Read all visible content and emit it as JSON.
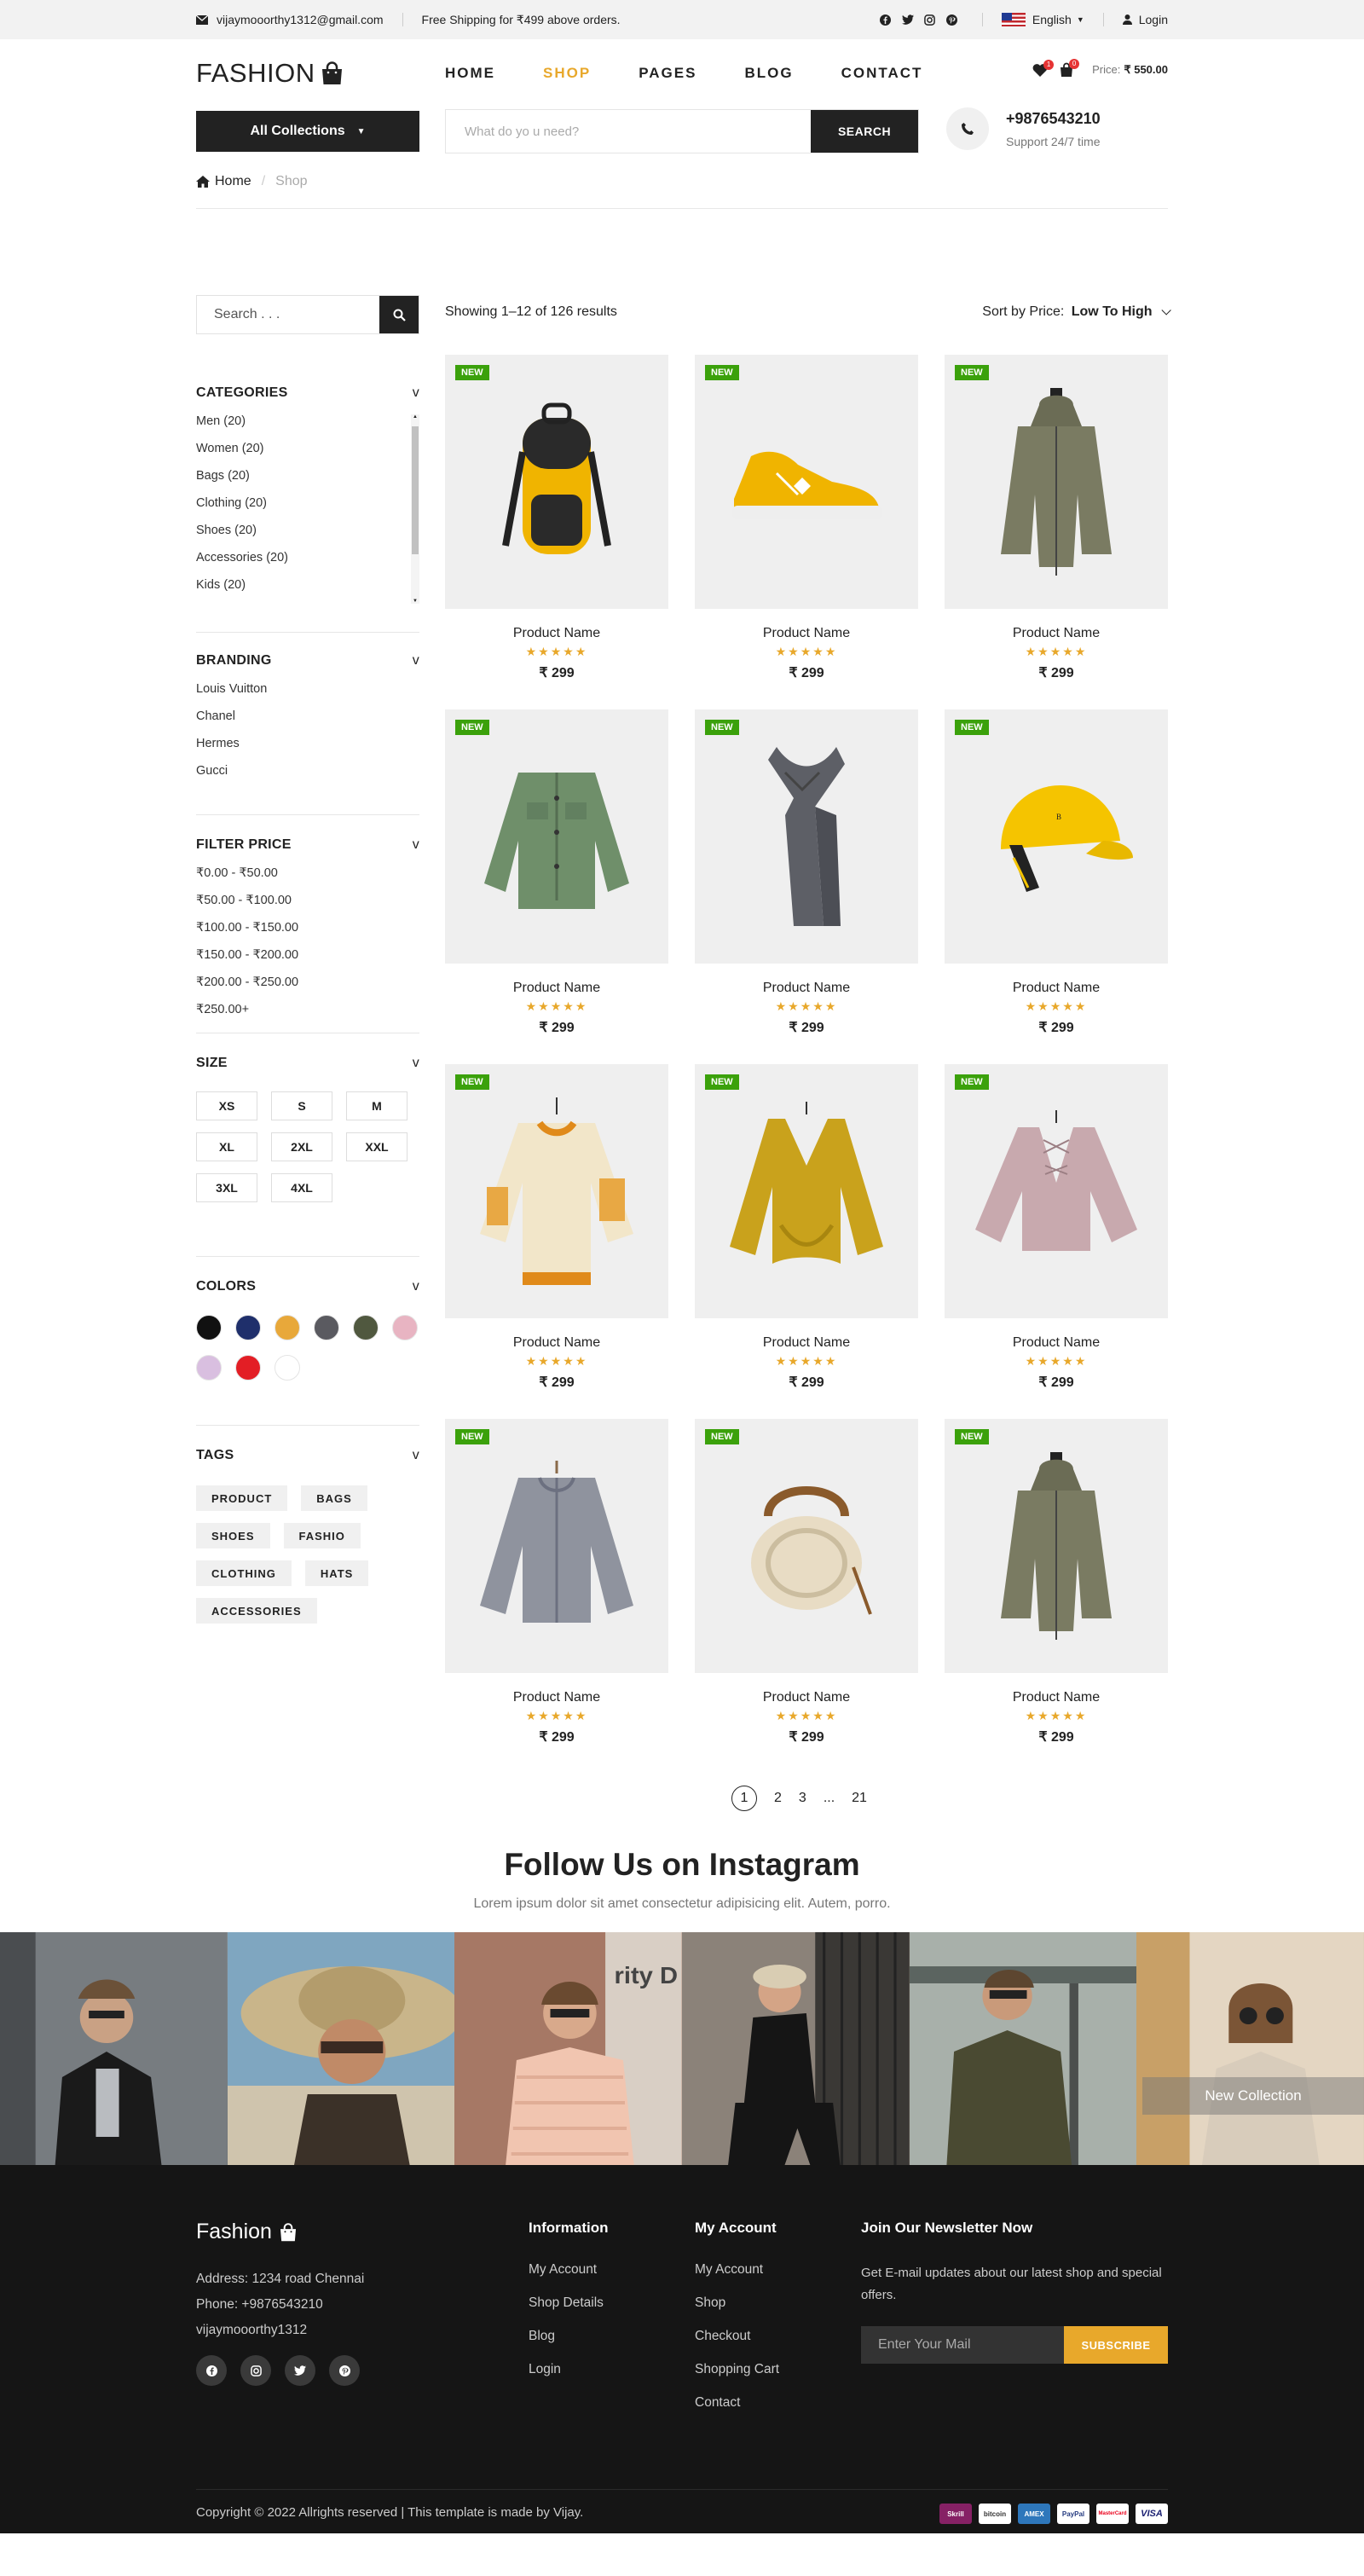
{
  "topbar": {
    "email": "vijaymooorthy1312@gmail.com",
    "shipping": "Free Shipping for ₹499 above orders.",
    "language": "English",
    "login": "Login"
  },
  "header": {
    "logo": "FASHION",
    "nav": [
      "HOME",
      "SHOP",
      "PAGES",
      "BLOG",
      "CONTACT"
    ],
    "active_nav": "SHOP",
    "wishlist_count": "1",
    "cart_count": "0",
    "price_label": "Price:",
    "price_value": "₹ 550.00"
  },
  "search": {
    "collections_label": "All Collections",
    "placeholder": "What do yo u need?",
    "button": "SEARCH"
  },
  "support": {
    "phone": "+9876543210",
    "text": "Support 24/7 time"
  },
  "breadcrumb": {
    "home": "Home",
    "current": "Shop"
  },
  "sidebar": {
    "search_placeholder": "Search . . .",
    "categories": {
      "title": "CATEGORIES",
      "items": [
        "Men (20)",
        "Women (20)",
        "Bags (20)",
        "Clothing (20)",
        "Shoes (20)",
        "Accessories (20)",
        "Kids (20)"
      ]
    },
    "branding": {
      "title": "BRANDING",
      "items": [
        "Louis Vuitton",
        "Chanel",
        "Hermes",
        "Gucci"
      ]
    },
    "price": {
      "title": "FILTER PRICE",
      "items": [
        "₹0.00 - ₹50.00",
        "₹50.00 - ₹100.00",
        "₹100.00 - ₹150.00",
        "₹150.00 - ₹200.00",
        "₹200.00 - ₹250.00",
        "₹250.00+"
      ]
    },
    "size": {
      "title": "SIZE",
      "items": [
        "XS",
        "S",
        "M",
        "XL",
        "2XL",
        "XXL",
        "3XL",
        "4XL"
      ]
    },
    "colors": {
      "title": "COLORS",
      "items": [
        "#111111",
        "#1f2f6b",
        "#e8a83a",
        "#5a5a60",
        "#50583f",
        "#e8b4c2",
        "#d9bfe0",
        "#e31e25",
        "#ffffff"
      ]
    },
    "tags": {
      "title": "TAGS",
      "items": [
        "PRODUCT",
        "BAGS",
        "SHOES",
        "FASHIO",
        "CLOTHING",
        "HATS",
        "ACCESSORIES"
      ]
    },
    "chevron": "v"
  },
  "shop": {
    "showing": "Showing 1–12 of 126 results",
    "sort_label": "Sort by Price:",
    "sort_value": "Low To High"
  },
  "products": [
    {
      "badge": "NEW",
      "name": "Product Name",
      "price": "₹ 299",
      "rating": 5,
      "icon": "backpack-image"
    },
    {
      "badge": "NEW",
      "name": "Product Name",
      "price": "₹ 299",
      "rating": 5,
      "icon": "sneaker-image"
    },
    {
      "badge": "NEW",
      "name": "Product Name",
      "price": "₹ 299",
      "rating": 5,
      "icon": "hooded-jacket-image"
    },
    {
      "badge": "NEW",
      "name": "Product Name",
      "price": "₹ 299",
      "rating": 5,
      "icon": "green-jacket-image"
    },
    {
      "badge": "NEW",
      "name": "Product Name",
      "price": "₹ 299",
      "rating": 5,
      "icon": "scarf-image"
    },
    {
      "badge": "NEW",
      "name": "Product Name",
      "price": "₹ 299",
      "rating": 5,
      "icon": "cap-image"
    },
    {
      "badge": "NEW",
      "name": "Product Name",
      "price": "₹ 299",
      "rating": 5,
      "icon": "cream-sweater-image"
    },
    {
      "badge": "NEW",
      "name": "Product Name",
      "price": "₹ 299",
      "rating": 5,
      "icon": "mustard-sweater-image"
    },
    {
      "badge": "NEW",
      "name": "Product Name",
      "price": "₹ 299",
      "rating": 5,
      "icon": "pink-sweater-image"
    },
    {
      "badge": "NEW",
      "name": "Product Name",
      "price": "₹ 299",
      "rating": 5,
      "icon": "grey-cardigan-image"
    },
    {
      "badge": "NEW",
      "name": "Product Name",
      "price": "₹ 299",
      "rating": 5,
      "icon": "rattan-bag-image"
    },
    {
      "badge": "NEW",
      "name": "Product Name",
      "price": "₹ 299",
      "rating": 5,
      "icon": "hooded-jacket-image"
    }
  ],
  "pagination": [
    "1",
    "2",
    "3",
    "...",
    "21"
  ],
  "instagram": {
    "title": "Follow Us on Instagram",
    "subtitle": "Lorem ipsum dolor sit amet consectetur adipisicing elit. Autem, porro.",
    "overlay": "New Collection"
  },
  "footer": {
    "logo": "Fashion",
    "address": "Address: 1234 road Chennai",
    "phone": "Phone: +9876543210",
    "email": "vijaymooorthy1312",
    "info_title": "Information",
    "info_links": [
      "My Account",
      "Shop Details",
      "Blog",
      "Login"
    ],
    "account_title": "My Account",
    "account_links": [
      "My Account",
      "Shop",
      "Checkout",
      "Shopping Cart",
      "Contact"
    ],
    "newsletter_title": "Join Our Newsletter Now",
    "newsletter_text": "Get E-mail updates about our latest shop and special offers.",
    "newsletter_placeholder": "Enter Your Mail",
    "newsletter_button": "SUBSCRIBE",
    "copyright": "Copyright © 2022 Allrights reserved | This template is made by Vijay.",
    "payments": [
      "Skrill",
      "bitcoin",
      "AMEX",
      "PayPal",
      "MasterCard",
      "VISA"
    ]
  },
  "colors": {
    "accent": "#e8a82b",
    "badge_green": "#3ba10b",
    "dark": "#222222",
    "footer_bg": "#151515"
  }
}
